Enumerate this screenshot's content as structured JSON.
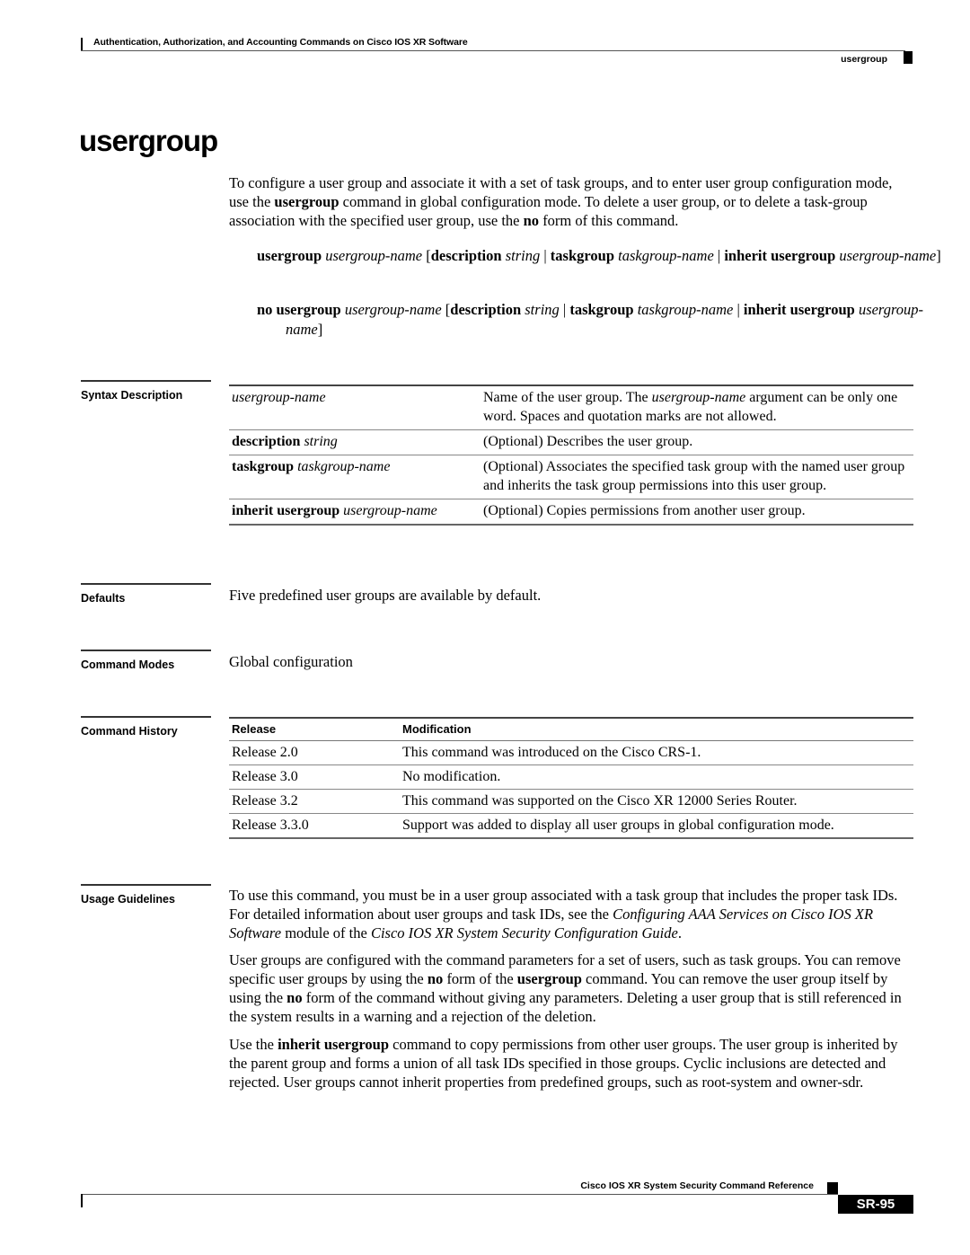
{
  "header": {
    "chapter_title": "Authentication, Authorization, and Accounting Commands on Cisco IOS XR Software",
    "running_command": "usergroup"
  },
  "page_title": "usergroup",
  "intro": {
    "p1": "To configure a user group and associate it with a set of task groups, and to enter user group configuration mode, use the ",
    "b1": "usergroup",
    "p2": " command in global configuration mode. To delete a user group, or to delete a task-group association with the specified user group, use the ",
    "b2": "no",
    "p3": " form of this command."
  },
  "syntax": {
    "line1": {
      "cmd": "usergroup",
      "arg": "usergroup-name",
      "open": " [",
      "kw_desc": "description",
      "arg_desc": "string",
      "sep": " | ",
      "kw_task": "taskgroup",
      "arg_task": "taskgroup-name",
      "kw_inherit": "inherit usergroup",
      "arg_inherit": "usergroup-name",
      "close": "]"
    },
    "line2": {
      "cmd": "no usergroup",
      "arg": "usergroup-name",
      "open": " [",
      "kw_desc": "description",
      "arg_desc": "string",
      "sep": " | ",
      "kw_task": "taskgroup",
      "arg_task": "taskgroup-name",
      "kw_inherit": "inherit usergroup",
      "arg_inherit": "usergroup-name",
      "close": "]"
    }
  },
  "sections": {
    "syntax_description": "Syntax Description",
    "defaults": "Defaults",
    "command_modes": "Command Modes",
    "command_history": "Command History",
    "usage_guidelines": "Usage Guidelines"
  },
  "syntax_table": [
    {
      "kw": "",
      "arg": "usergroup-name",
      "desc_pre": "Name of the user group. The ",
      "desc_it": "usergroup-name",
      "desc_post": " argument can be only one word. Spaces and quotation marks are not allowed."
    },
    {
      "kw": "description",
      "arg": "string",
      "desc_pre": "(Optional) Describes the user group.",
      "desc_it": "",
      "desc_post": ""
    },
    {
      "kw": "taskgroup",
      "arg": "taskgroup-name",
      "desc_pre": "(Optional) Associates the specified task group with the named user group and inherits the task group permissions into this user group.",
      "desc_it": "",
      "desc_post": ""
    },
    {
      "kw": "inherit usergroup",
      "arg": "usergroup-name",
      "desc_pre": "(Optional) Copies permissions from another user group.",
      "desc_it": "",
      "desc_post": ""
    }
  ],
  "defaults_text": "Five predefined user groups are available by default.",
  "command_modes_text": "Global configuration",
  "history": {
    "col_release": "Release",
    "col_modification": "Modification",
    "rows": [
      {
        "release": "Release 2.0",
        "modification": "This command was introduced on the Cisco CRS-1."
      },
      {
        "release": "Release 3.0",
        "modification": "No modification."
      },
      {
        "release": "Release 3.2",
        "modification": "This command was supported on the Cisco XR 12000 Series Router."
      },
      {
        "release": "Release 3.3.0",
        "modification": "Support was added to display all user groups in global configuration mode."
      }
    ]
  },
  "usage": {
    "p1": {
      "t1": "To use this command, you must be in a user group associated with a task group that includes the proper task IDs. For detailed information about user groups and task IDs, see the ",
      "i1": "Configuring AAA Services on Cisco IOS XR Software",
      "t2": " module of the ",
      "i2": "Cisco IOS XR System Security Configuration Guide",
      "t3": "."
    },
    "p2": {
      "t1": "User groups are configured with the command parameters for a set of users, such as task groups. You can remove specific user groups by using the ",
      "b1": "no",
      "t2": " form of the ",
      "b2": "usergroup",
      "t3": " command. You can remove the user group itself by using the ",
      "b3": "no",
      "t4": " form of the command without giving any parameters. Deleting a user group that is still referenced in the system results in a warning and a rejection of the deletion."
    },
    "p3": {
      "t1": "Use the ",
      "b1": "inherit usergroup",
      "t2": " command to copy permissions from other user groups. The user group is inherited by the parent group and forms a union of all task IDs specified in those groups. Cyclic inclusions are detected and rejected. User groups cannot inherit properties from predefined groups, such as root-system and owner-sdr."
    }
  },
  "footer": {
    "book_title": "Cisco IOS XR System Security Command Reference",
    "page_number": "SR-95"
  }
}
